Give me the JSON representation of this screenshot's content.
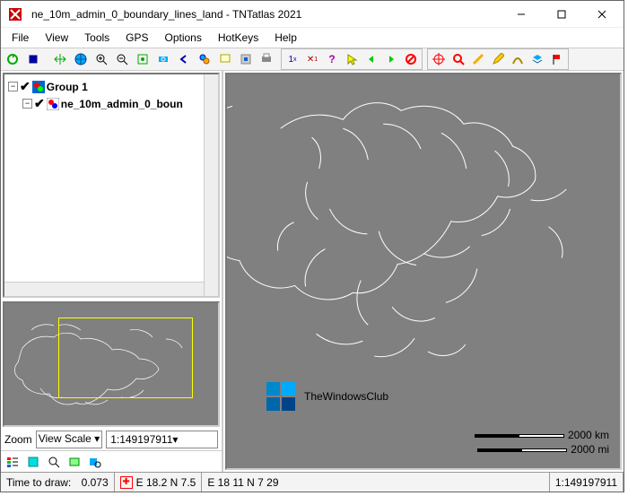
{
  "title": "ne_10m_admin_0_boundary_lines_land - TNTatlas 2021",
  "menu": [
    "File",
    "View",
    "Tools",
    "GPS",
    "Options",
    "HotKeys",
    "Help"
  ],
  "tree": {
    "group_label": "Group 1",
    "layer_label": "ne_10m_admin_0_boun"
  },
  "zoom": {
    "label": "Zoom",
    "mode": "View Scale",
    "scale": "1:149197911"
  },
  "status": {
    "draw_label": "Time to draw:",
    "draw_value": "0.073",
    "coords": "E 18.2  N 7.5",
    "coords2": "E 18 11  N 7 29",
    "scale2": "1:149197911"
  },
  "scalebar": {
    "km": "2000 km",
    "mi": "2000 mi"
  },
  "watermark": "TheWindowsClub"
}
